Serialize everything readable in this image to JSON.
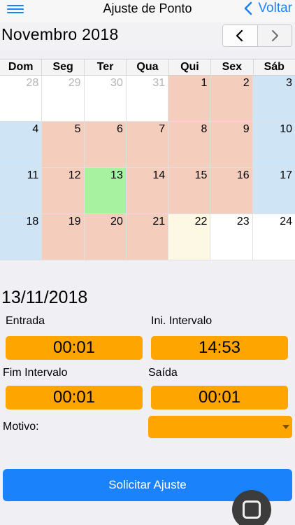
{
  "navbar": {
    "title": "Ajuste de Ponto",
    "back_label": "Voltar"
  },
  "calendar": {
    "month_title": "Novembro 2018",
    "weekdays": [
      "Dom",
      "Seg",
      "Ter",
      "Qua",
      "Qui",
      "Sex",
      "Sáb"
    ],
    "legend_colors": {
      "workday": "#f4cdbd",
      "weekend": "#cfe4f4",
      "selected": "#a6f2a0",
      "today": "#fcf8e3"
    },
    "days": [
      {
        "n": "28",
        "type": "other"
      },
      {
        "n": "29",
        "type": "other"
      },
      {
        "n": "30",
        "type": "other"
      },
      {
        "n": "31",
        "type": "other"
      },
      {
        "n": "1",
        "type": "workday"
      },
      {
        "n": "2",
        "type": "workday"
      },
      {
        "n": "3",
        "type": "weekend"
      },
      {
        "n": "4",
        "type": "weekend"
      },
      {
        "n": "5",
        "type": "workday"
      },
      {
        "n": "6",
        "type": "workday"
      },
      {
        "n": "7",
        "type": "workday"
      },
      {
        "n": "8",
        "type": "workday"
      },
      {
        "n": "9",
        "type": "workday"
      },
      {
        "n": "10",
        "type": "weekend"
      },
      {
        "n": "11",
        "type": "weekend"
      },
      {
        "n": "12",
        "type": "workday"
      },
      {
        "n": "13",
        "type": "selected"
      },
      {
        "n": "14",
        "type": "workday"
      },
      {
        "n": "15",
        "type": "workday"
      },
      {
        "n": "16",
        "type": "workday"
      },
      {
        "n": "17",
        "type": "weekend"
      },
      {
        "n": "18",
        "type": "weekend"
      },
      {
        "n": "19",
        "type": "workday"
      },
      {
        "n": "20",
        "type": "workday"
      },
      {
        "n": "21",
        "type": "workday"
      },
      {
        "n": "22",
        "type": "today"
      },
      {
        "n": "23",
        "type": "future"
      },
      {
        "n": "24",
        "type": "future"
      }
    ]
  },
  "form": {
    "date": "13/11/2018",
    "entrada_label": "Entrada",
    "entrada_value": "00:01",
    "ini_intervalo_label": "Ini. Intervalo",
    "ini_intervalo_value": "14:53",
    "fim_intervalo_label": "Fim Intervalo",
    "fim_intervalo_value": "00:01",
    "saida_label": "Saída",
    "saida_value": "00:01",
    "motivo_label": "Motivo:",
    "motivo_value": ""
  },
  "actions": {
    "submit_label": "Solicitar Ajuste"
  },
  "icons": {
    "menu": "hamburger-menu-icon",
    "back": "chevron-left-icon",
    "prev_month": "chevron-left-icon",
    "next_month": "chevron-right-icon",
    "floating": "square-icon"
  },
  "colors": {
    "accent": "#1a82fb",
    "field": "#ffa500"
  }
}
